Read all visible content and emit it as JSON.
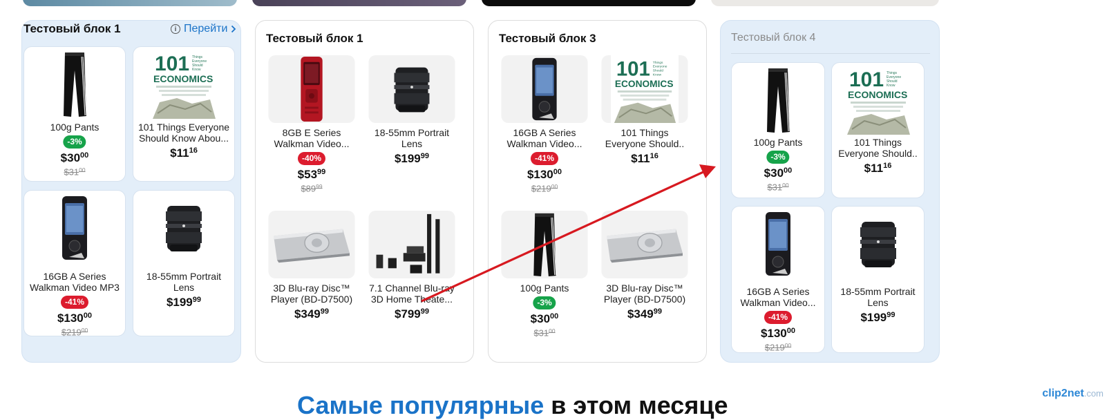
{
  "blocks": [
    {
      "title": "Тестовый блок 1",
      "link_label": "Перейти",
      "products": [
        {
          "name": "100g Pants",
          "badge": "-3%",
          "price": "$30",
          "price_cents": "00",
          "old_price": "$31",
          "old_cents": "00",
          "image": "pants"
        },
        {
          "name": "101 Things Everyone Should Know Abou...",
          "price": "$11",
          "price_cents": "16",
          "image": "book"
        },
        {
          "name": "16GB A Series Walkman Video MP3",
          "badge": "-41%",
          "price": "$130",
          "price_cents": "00",
          "old_price": "$219",
          "old_cents": "00",
          "image": "walkman"
        },
        {
          "name": "18-55mm Portrait Lens",
          "price": "$199",
          "price_cents": "99",
          "image": "lens"
        }
      ]
    },
    {
      "title": "Тестовый блок 1",
      "products": [
        {
          "name": "8GB E Series Walkman Video...",
          "badge": "-40%",
          "price": "$53",
          "price_cents": "99",
          "old_price": "$89",
          "old_cents": "99",
          "image": "red-walkman"
        },
        {
          "name": "18-55mm Portrait Lens",
          "price": "$199",
          "price_cents": "99",
          "image": "lens"
        },
        {
          "name": "3D Blu-ray Disc™ Player (BD-D7500)",
          "price": "$349",
          "price_cents": "99",
          "image": "bluray"
        },
        {
          "name": "7.1 Channel Blu-ray 3D Home Theate...",
          "price": "$799",
          "price_cents": "99",
          "image": "home-theater"
        }
      ]
    },
    {
      "title": "Тестовый блок 3",
      "products": [
        {
          "name": "16GB A Series Walkman Video...",
          "badge": "-41%",
          "price": "$130",
          "price_cents": "00",
          "old_price": "$219",
          "old_cents": "00",
          "image": "walkman"
        },
        {
          "name": "101 Things Everyone Should..",
          "price": "$11",
          "price_cents": "16",
          "image": "book"
        },
        {
          "name": "100g Pants",
          "badge": "-3%",
          "price": "$30",
          "price_cents": "00",
          "old_price": "$31",
          "old_cents": "00",
          "image": "pants"
        },
        {
          "name": "3D Blu-ray Disc™ Player (BD-D7500)",
          "price": "$349",
          "price_cents": "99",
          "image": "bluray"
        }
      ]
    },
    {
      "title": "Тестовый блок 4",
      "products": [
        {
          "name": "100g Pants",
          "badge": "-3%",
          "price": "$30",
          "price_cents": "00",
          "old_price": "$31",
          "old_cents": "00",
          "image": "pants"
        },
        {
          "name": "101 Things Everyone Should..",
          "price": "$11",
          "price_cents": "16",
          "image": "book"
        },
        {
          "name": "16GB A Series Walkman Video...",
          "badge": "-41%",
          "price": "$130",
          "price_cents": "00",
          "old_price": "$219",
          "old_cents": "00",
          "image": "walkman"
        },
        {
          "name": "18-55mm Portrait Lens",
          "price": "$199",
          "price_cents": "99",
          "image": "lens"
        }
      ]
    }
  ],
  "book_cover": {
    "number": "101",
    "word": "ECONOMICS"
  },
  "footer": {
    "heading_accent": "Самые популярные",
    "heading_rest": "в этом месяце"
  },
  "watermark": {
    "brand": "clip2net",
    "suffix": ".com"
  },
  "colors": {
    "accent": "#1a73c8",
    "discount_green": "#16a34a",
    "discount_red": "#dc1c2e",
    "annotation_arrow": "#d71920"
  }
}
